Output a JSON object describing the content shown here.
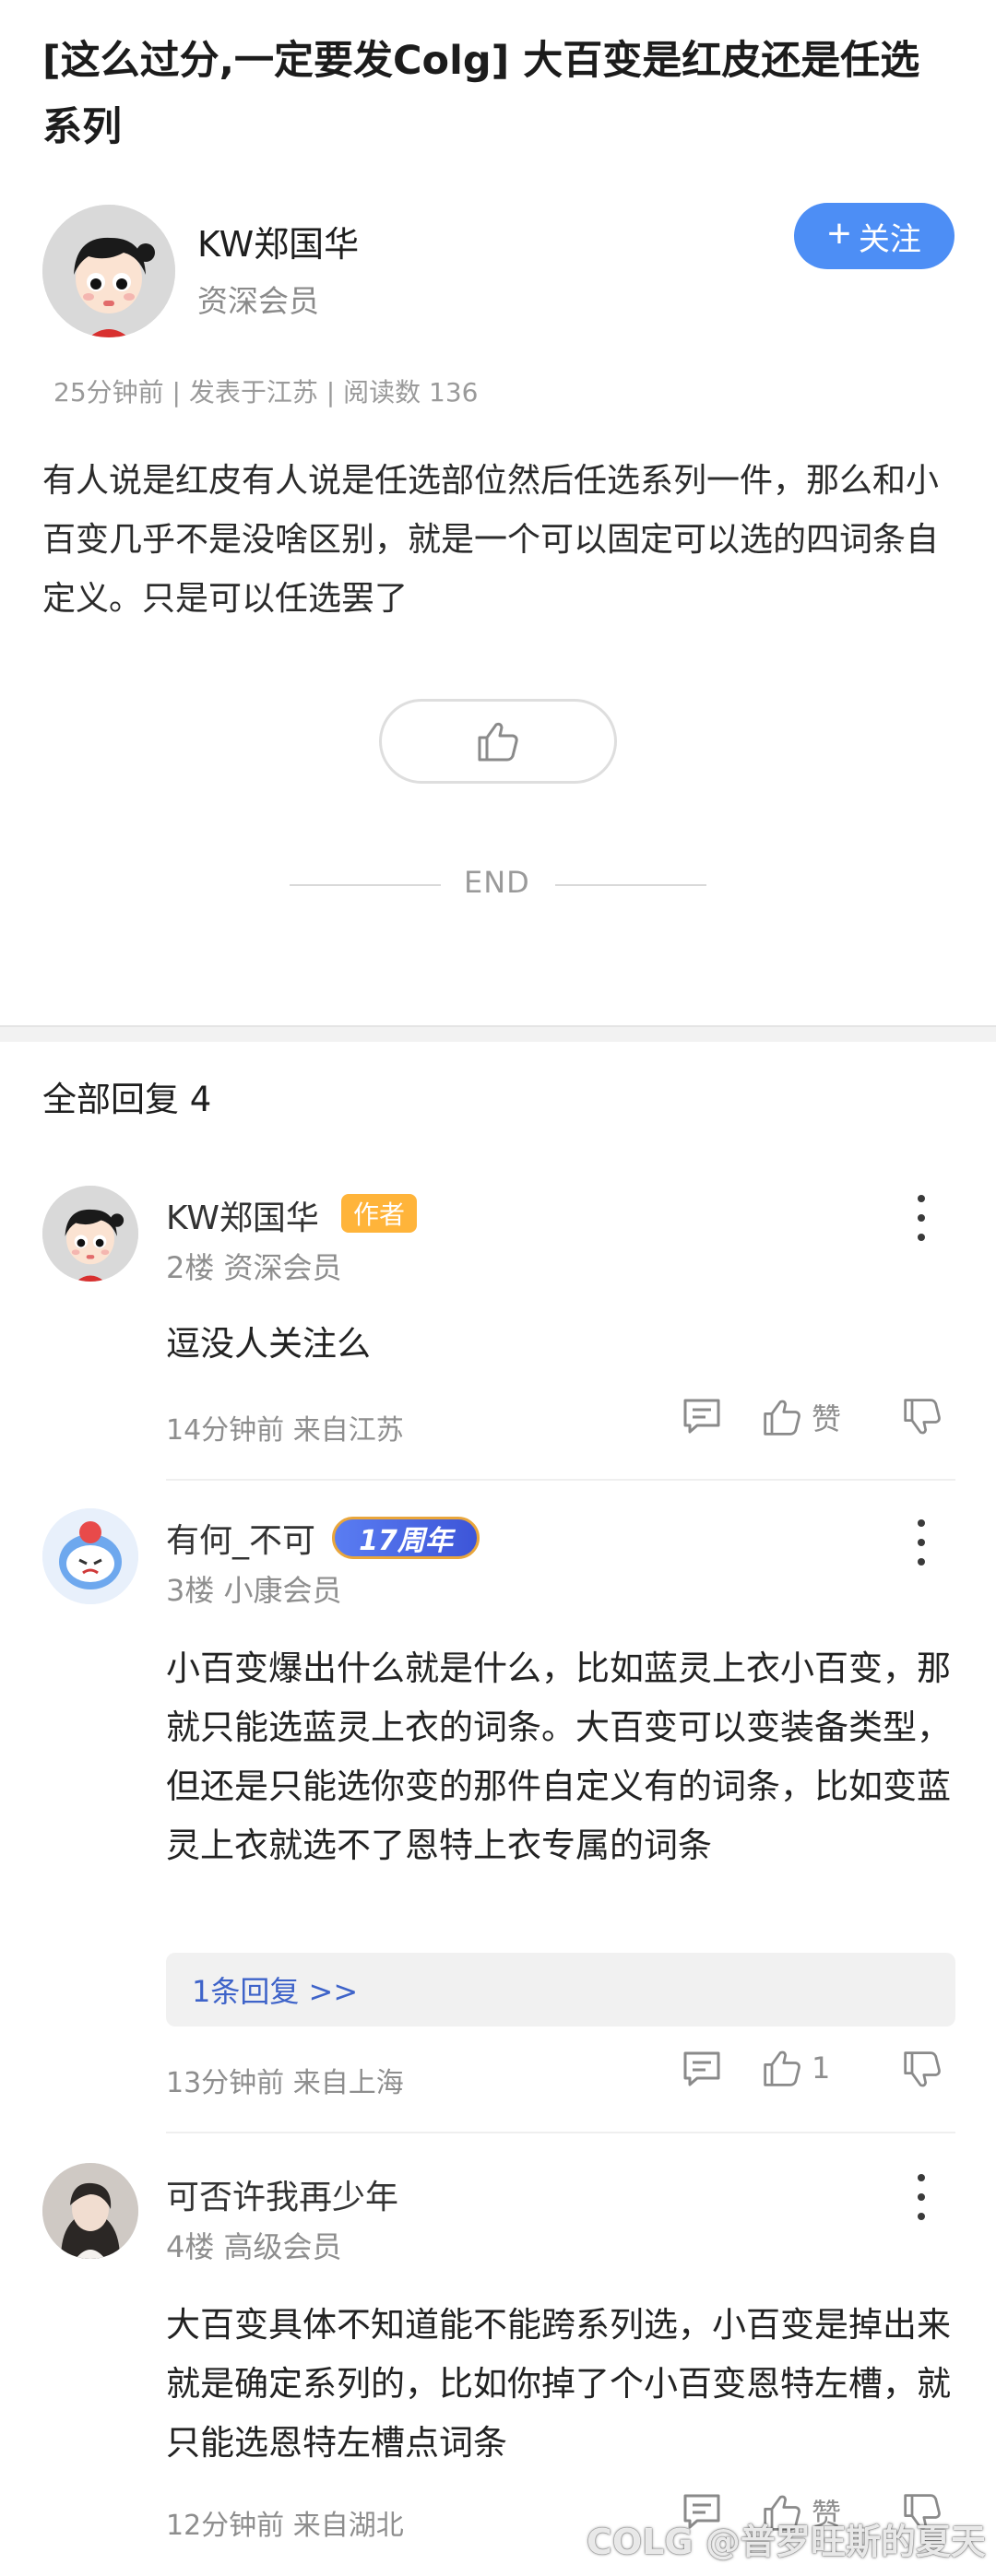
{
  "post": {
    "title": "[这么过分,一定要发Colg] 大百变是红皮还是任选系列",
    "author_name": "KW郑国华",
    "author_level": "资深会员",
    "follow_label": "关注",
    "meta": "25分钟前 | 发表于江苏 | 阅读数 136",
    "body": "有人说是红皮有人说是任选部位然后任选系列一件，那么和小百变几乎不是没啥区别，就是一个可以固定可以选的四词条自定义。只是可以任选罢了",
    "end_label": "END"
  },
  "replies": {
    "header": "全部回复  4",
    "items": [
      {
        "name": "KW郑国华",
        "badge": "作者",
        "level": "2楼 资深会员",
        "text": "逗没人关注么",
        "time": "14分钟前 来自江苏",
        "like_label": "赞"
      },
      {
        "name": "有何_不可",
        "badge": "17周年",
        "level": "3楼 小康会员",
        "text": "小百变爆出什么就是什么，比如蓝灵上衣小百变，那就只能选蓝灵上衣的词条。大百变可以变装备类型，但还是只能选你变的那件自定义有的词条，比如变蓝灵上衣就选不了恩特上衣专属的词条",
        "sub_reply": "1条回复 >>",
        "time": "13分钟前 来自上海",
        "like_label": "1"
      },
      {
        "name": "可否许我再少年",
        "level": "4楼 高级会员",
        "text": "大百变具体不知道能不能跨系列选，小百变是掉出来就是确定系列的，比如你掉了个小百变恩特左槽，就只能选恩特左槽点词条",
        "time": "12分钟前 来自湖北",
        "like_label": "赞"
      }
    ]
  },
  "watermark": "COLG @普罗旺斯的夏天",
  "colors": {
    "accent": "#4d8ef5",
    "author_badge": "#ffb43a",
    "sub_reply_link": "#3e63c9"
  }
}
